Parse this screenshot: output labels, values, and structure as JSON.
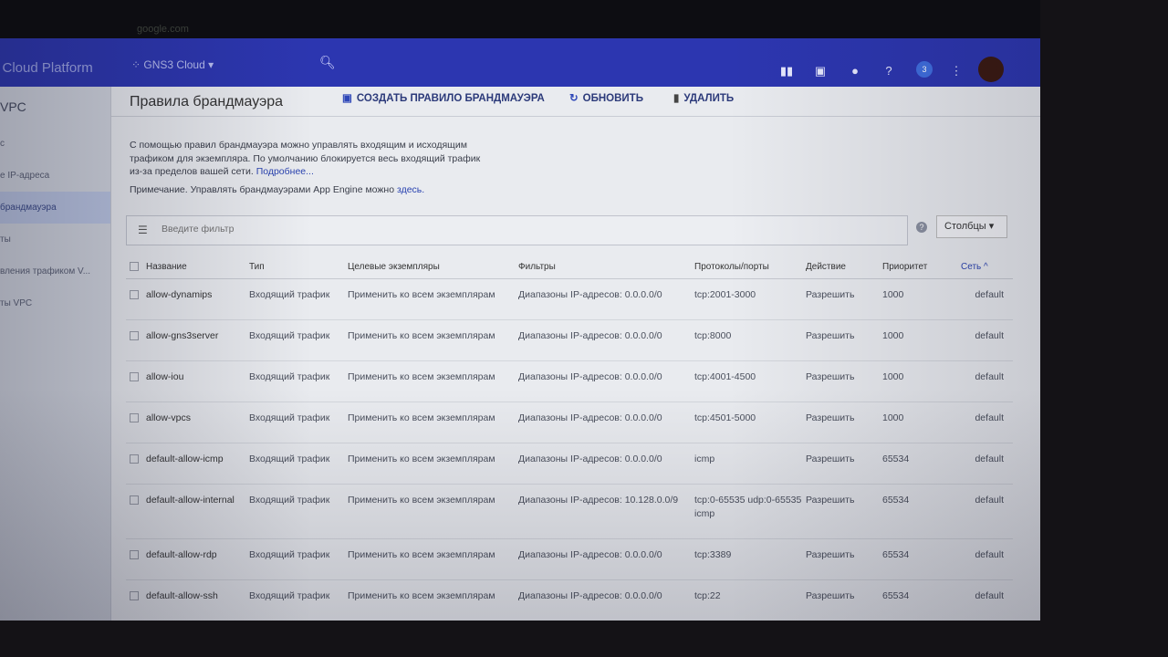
{
  "browser": {
    "url": "google.com"
  },
  "header": {
    "brand": "e Cloud Platform",
    "project": "GNS3 Cloud",
    "badge": "3"
  },
  "sidebar": {
    "title": "VPC",
    "items": [
      "с",
      "е IP-адреса",
      "брандмауэра",
      "ты",
      "вления трафиком V...",
      "ты VPC"
    ],
    "active_index": 2
  },
  "page": {
    "title": "Правила брандмауэра",
    "create": "СОЗДАТЬ ПРАВИЛО БРАНДМАУЭРА",
    "refresh": "ОБНОВИТЬ",
    "delete": "УДАЛИТЬ",
    "description": "С помощью правил брандмауэра можно управлять входящим и исходящим трафиком для экземпляра. По умолчанию блокируется весь входящий трафик из-за пределов вашей сети.",
    "more_link": "Подробнее...",
    "note": "Примечание. Управлять брандмауэрами App Engine можно",
    "note_link": "здесь.",
    "filter_placeholder": "Введите фильтр",
    "columns_button": "Столбцы"
  },
  "table": {
    "headers": [
      "Название",
      "Тип",
      "Целевые экземпляры",
      "Фильтры",
      "Протоколы/порты",
      "Действие",
      "Приоритет",
      "Сеть ^"
    ],
    "rows": [
      {
        "name": "allow-dynamips",
        "type": "Входящий трафик",
        "targets": "Применить ко всем экземплярам",
        "filters": "Диапазоны IP-адресов: 0.0.0.0/0",
        "ports": "tcp:2001-3000",
        "action": "Разрешить",
        "priority": "1000",
        "network": "default"
      },
      {
        "name": "allow-gns3server",
        "type": "Входящий трафик",
        "targets": "Применить ко всем экземплярам",
        "filters": "Диапазоны IP-адресов: 0.0.0.0/0",
        "ports": "tcp:8000",
        "action": "Разрешить",
        "priority": "1000",
        "network": "default"
      },
      {
        "name": "allow-iou",
        "type": "Входящий трафик",
        "targets": "Применить ко всем экземплярам",
        "filters": "Диапазоны IP-адресов: 0.0.0.0/0",
        "ports": "tcp:4001-4500",
        "action": "Разрешить",
        "priority": "1000",
        "network": "default"
      },
      {
        "name": "allow-vpcs",
        "type": "Входящий трафик",
        "targets": "Применить ко всем экземплярам",
        "filters": "Диапазоны IP-адресов: 0.0.0.0/0",
        "ports": "tcp:4501-5000",
        "action": "Разрешить",
        "priority": "1000",
        "network": "default"
      },
      {
        "name": "default-allow-icmp",
        "type": "Входящий трафик",
        "targets": "Применить ко всем экземплярам",
        "filters": "Диапазоны IP-адресов: 0.0.0.0/0",
        "ports": "icmp",
        "action": "Разрешить",
        "priority": "65534",
        "network": "default"
      },
      {
        "name": "default-allow-internal",
        "type": "Входящий трафик",
        "targets": "Применить ко всем экземплярам",
        "filters": "Диапазоны IP-адресов: 10.128.0.0/9",
        "ports": "tcp:0-65535 udp:0-65535 icmp",
        "action": "Разрешить",
        "priority": "65534",
        "network": "default"
      },
      {
        "name": "default-allow-rdp",
        "type": "Входящий трафик",
        "targets": "Применить ко всем экземплярам",
        "filters": "Диапазоны IP-адресов: 0.0.0.0/0",
        "ports": "tcp:3389",
        "action": "Разрешить",
        "priority": "65534",
        "network": "default"
      },
      {
        "name": "default-allow-ssh",
        "type": "Входящий трафик",
        "targets": "Применить ко всем экземплярам",
        "filters": "Диапазоны IP-адресов: 0.0.0.0/0",
        "ports": "tcp:22",
        "action": "Разрешить",
        "priority": "65534",
        "network": "default"
      }
    ]
  }
}
